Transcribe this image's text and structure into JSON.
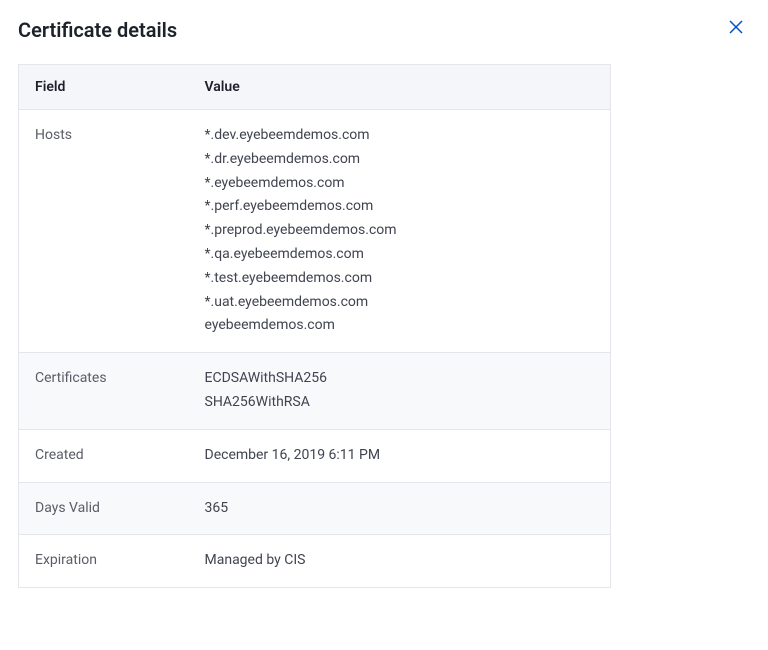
{
  "modal": {
    "title": "Certificate details",
    "close_label": "Close"
  },
  "table": {
    "headers": {
      "field": "Field",
      "value": "Value"
    },
    "rows": [
      {
        "field": "Hosts",
        "value": [
          "*.dev.eyebeemdemos.com",
          "*.dr.eyebeemdemos.com",
          "*.eyebeemdemos.com",
          "*.perf.eyebeemdemos.com",
          "*.preprod.eyebeemdemos.com",
          "*.qa.eyebeemdemos.com",
          "*.test.eyebeemdemos.com",
          "*.uat.eyebeemdemos.com",
          "eyebeemdemos.com"
        ]
      },
      {
        "field": "Certificates",
        "value": [
          "ECDSAWithSHA256",
          "SHA256WithRSA"
        ]
      },
      {
        "field": "Created",
        "value": "December 16, 2019 6:11 PM"
      },
      {
        "field": "Days Valid",
        "value": "365"
      },
      {
        "field": "Expiration",
        "value": "Managed by CIS"
      }
    ]
  }
}
